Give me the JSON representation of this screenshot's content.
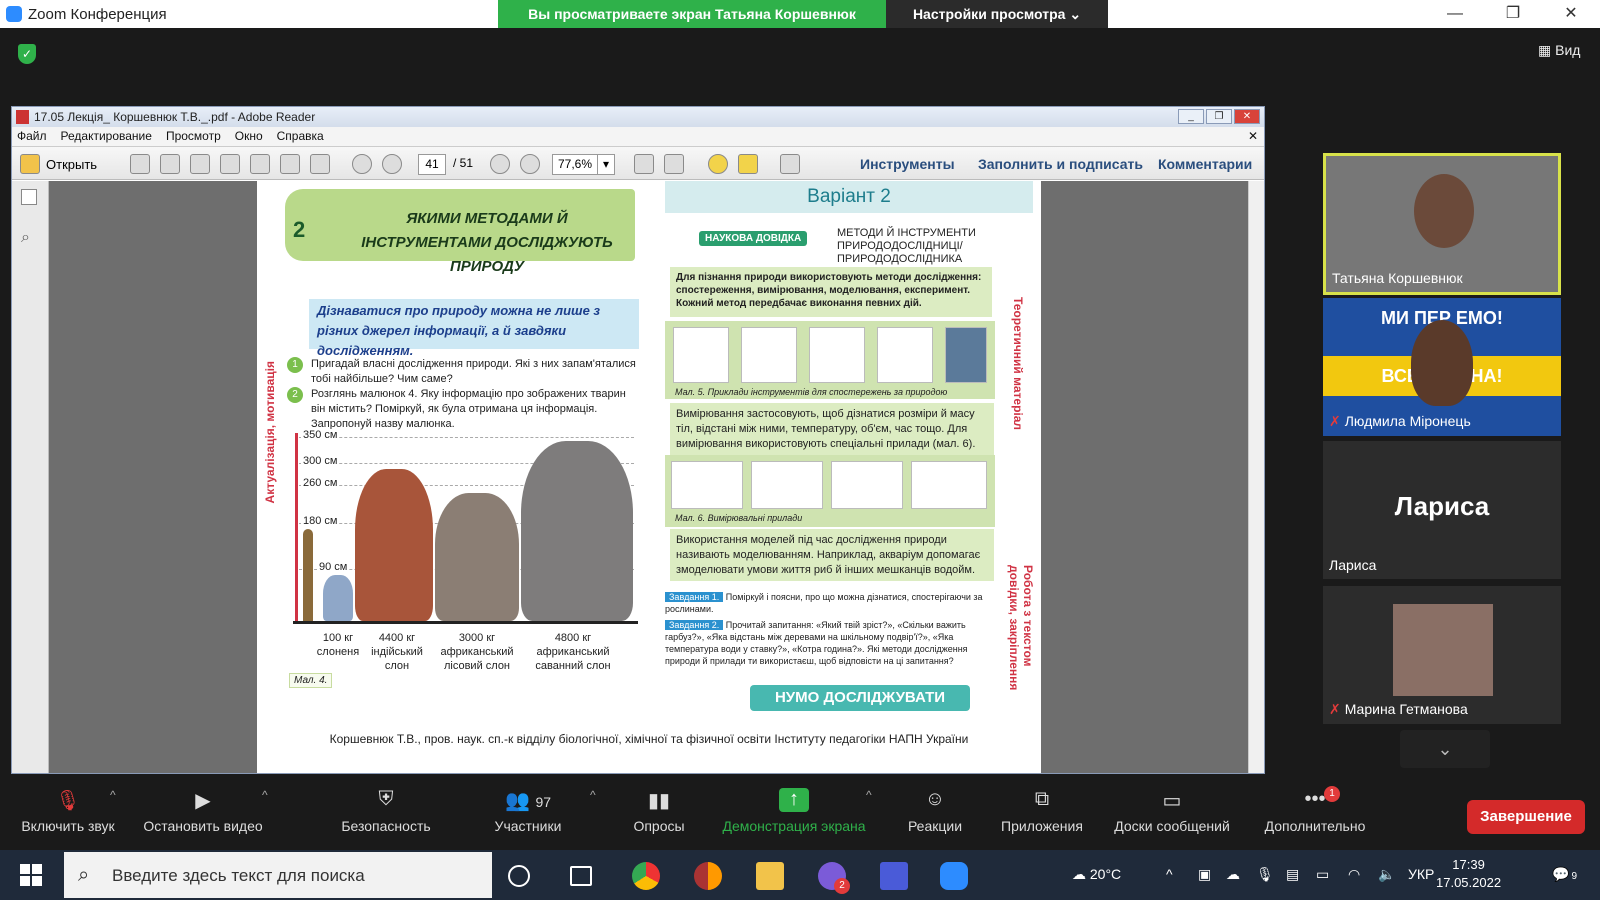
{
  "window": {
    "title": "Zoom Конференция",
    "share_banner": "Вы просматриваете экран Татьяна Коршевнюк",
    "view_options": "Настройки просмотра",
    "view_button": "Вид"
  },
  "adobe": {
    "title": "17.05 Лекція_ Коршевнюк Т.В._.pdf - Adobe Reader",
    "menu": [
      "Файл",
      "Редактирование",
      "Просмотр",
      "Окно",
      "Справка"
    ],
    "open_label": "Открыть",
    "page_current": "41",
    "page_total": "/ 51",
    "zoom": "77,6%",
    "tools": "Инструменты",
    "fill_sign": "Заполнить и подписать",
    "comments": "Комментарии"
  },
  "pdf": {
    "chapter": "2",
    "heading": "ЯКИМИ МЕТОДАМИ Й ІНСТРУМЕНТАМИ ДОСЛІДЖУЮТЬ ПРИРОДУ",
    "intro": "Дізнаватися про природу можна не лише з різних джерел інформації, а й завдяки дослідженням.",
    "q1": "Пригадай власні дослідження природи. Які з них запам'яталися тобі найбільше? Чим саме?",
    "q2": "Розглянь малюнок 4. Яку інформацію про зображених тварин він містить? Поміркуй, як була отримана ця інформація. Запропонуй назву малюнка.",
    "side_left": "Актуалізація, мотивація",
    "heights": [
      "350 см",
      "300 см",
      "260 см",
      "180 см",
      "90 см"
    ],
    "animals": [
      {
        "w": "100 кг",
        "n": "слоненя"
      },
      {
        "w": "4400 кг",
        "n": "індійський слон"
      },
      {
        "w": "3000 кг",
        "n": "африканський лісовий слон"
      },
      {
        "w": "4800 кг",
        "n": "африканський саванний слон"
      }
    ],
    "fig4": "Мал. 4.",
    "variant": "Варіант 2",
    "ref_badge": "НАУКОВА ДОВІДКА",
    "ref_title": "МЕТОДИ Й ІНСТРУМЕНТИ ПРИРОДОДОСЛІДНИЦІ/ ПРИРОДОДОСЛІДНИКА",
    "ref_text": "Для пізнання природи використовують методи дослідження: спостереження, вимірювання, моделювання, експеримент. Кожний метод передбачає виконання певних дій.",
    "cap5": "Мал. 5. Приклади інструментів для спостережень за природою",
    "measure": "Вимірювання застосовують, щоб дізнатися розміри й масу тіл, відстані між ними, температуру, об'єм, час тощо. Для вимірювання використовують спеціальні прилади (мал. 6).",
    "cap6": "Мал. 6. Вимірювальні прилади",
    "model": "Використання моделей під час дослідження природи називають моделюванням. Наприклад, акваріум допомагає змоделювати умови життя риб й інших мешканців водойм.",
    "side_right1": "Теоретичний матеріал",
    "side_right2": "Робота з текстом довідки, закріплення",
    "task1_label": "Завдання 1.",
    "task1": "Поміркуй і поясни, про що можна дізнатися, спостерігаючи за рослинами.",
    "task2_label": "Завдання 2.",
    "task2": "Прочитай запитання: «Який твій зріст?», «Скільки важить гарбуз?», «Яка відстань між деревами на шкільному подвір'ї?», «Яка температура води у ставку?», «Котра година?». Які методи дослідження природи й прилади ти використаєш, щоб відповісти на ці запитання?",
    "nuumo": "НУМО ДОСЛІДЖУВАТИ",
    "footer": "Коршевнюк Т.В., пров. наук. сп.-к відділу біологічної, хімічної та фізичної освіти Інституту педагогіки НАПН України"
  },
  "participants": [
    {
      "name": "Татьяна Коршевнюк"
    },
    {
      "name": "Людмила Міронець",
      "banner_top": "МИ ПЕР       ЕМО!",
      "banner_bottom": "ВСЕ БУ        АЇНА!"
    },
    {
      "name": "Лариса",
      "big": "Лариса"
    },
    {
      "name": "Марина Гетманова"
    }
  ],
  "controls": {
    "mic": "Включить звук",
    "video": "Остановить видео",
    "security": "Безопасность",
    "participants": "Участники",
    "participants_count": "97",
    "polls": "Опросы",
    "share": "Демонстрация экрана",
    "reactions": "Реакции",
    "apps": "Приложения",
    "boards": "Доски сообщений",
    "more": "Дополнительно",
    "more_badge": "1",
    "end": "Завершение"
  },
  "taskbar": {
    "search_placeholder": "Введите здесь текст для поиска",
    "weather": "20°C",
    "lang": "УКР",
    "time": "17:39",
    "date": "17.05.2022",
    "notif": "9",
    "viber_badge": "2"
  }
}
